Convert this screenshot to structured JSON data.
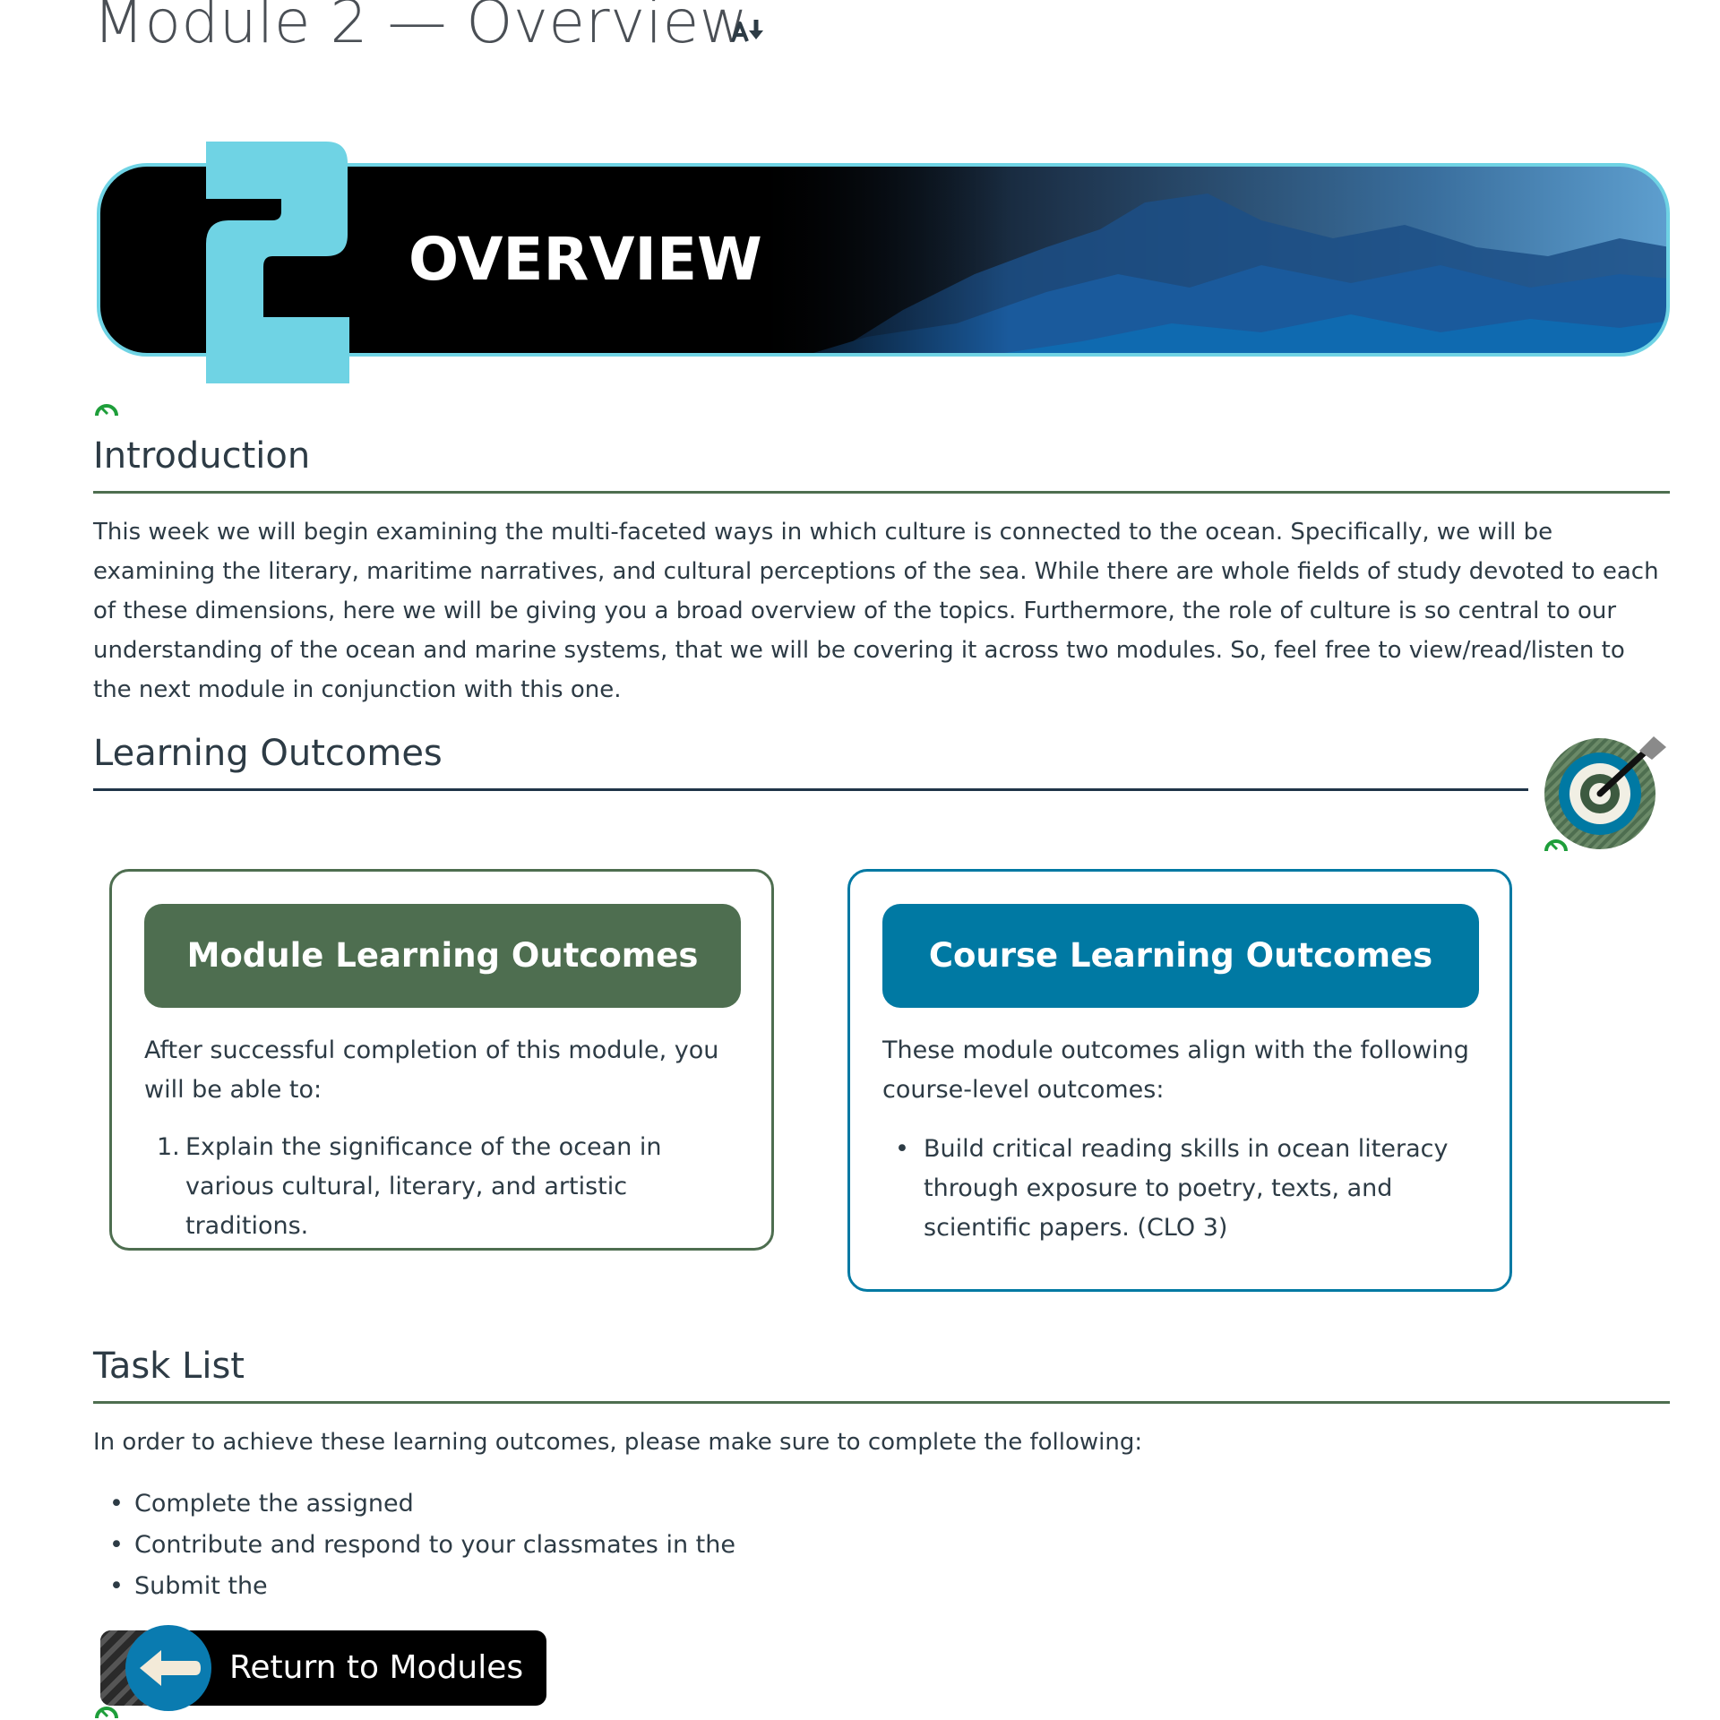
{
  "page": {
    "title": "Module 2 — Overview"
  },
  "banner": {
    "number": "2",
    "label": "OVERVIEW"
  },
  "introduction": {
    "heading": "Introduction",
    "text": "This week we will begin examining the multi-faceted ways in which culture is connected to the ocean. Specifically, we will be examining the literary, maritime narratives, and cultural perceptions of the sea. While there are whole fields of study devoted to each of these dimensions, here we will be giving you a broad overview of the topics. Furthermore, the role of culture is so central to our understanding of the ocean and marine systems, that we will be covering it across two modules. So, feel free to view/read/listen to the next module in conjunction with this one."
  },
  "learning_outcomes": {
    "heading": "Learning Outcomes",
    "module_card": {
      "title": "Module Learning Outcomes",
      "intro": "After successful completion of this module, you will be able to:",
      "items": [
        {
          "marker": "1.",
          "text": "Explain the significance of the ocean in various cultural, literary, and artistic traditions."
        }
      ]
    },
    "course_card": {
      "title": "Course Learning Outcomes",
      "intro": "These module outcomes align with the following course-level outcomes:",
      "items": [
        {
          "marker": "•",
          "text": "Build critical reading skills in ocean literacy through exposure to poetry, texts, and scientific papers. (CLO 3)"
        }
      ]
    }
  },
  "task_list": {
    "heading": "Task List",
    "intro": "In order to achieve these learning outcomes, please make sure to complete the following:",
    "items": [
      {
        "marker": "•",
        "text": "Complete the assigned"
      },
      {
        "marker": "•",
        "text": "Contribute and respond to your classmates in the"
      },
      {
        "marker": "•",
        "text": "Submit the"
      }
    ]
  },
  "return_button": {
    "label": "Return to Modules"
  },
  "colors": {
    "module_green": "#4e6e50",
    "course_blue": "#0079a3",
    "banner_cyan": "#6fd3e4",
    "rule_dark": "#1f3448",
    "reload_green": "#1e9e3a"
  },
  "icons": [
    "sort-icon",
    "reload-icon",
    "target-icon",
    "arrow-left-icon"
  ]
}
